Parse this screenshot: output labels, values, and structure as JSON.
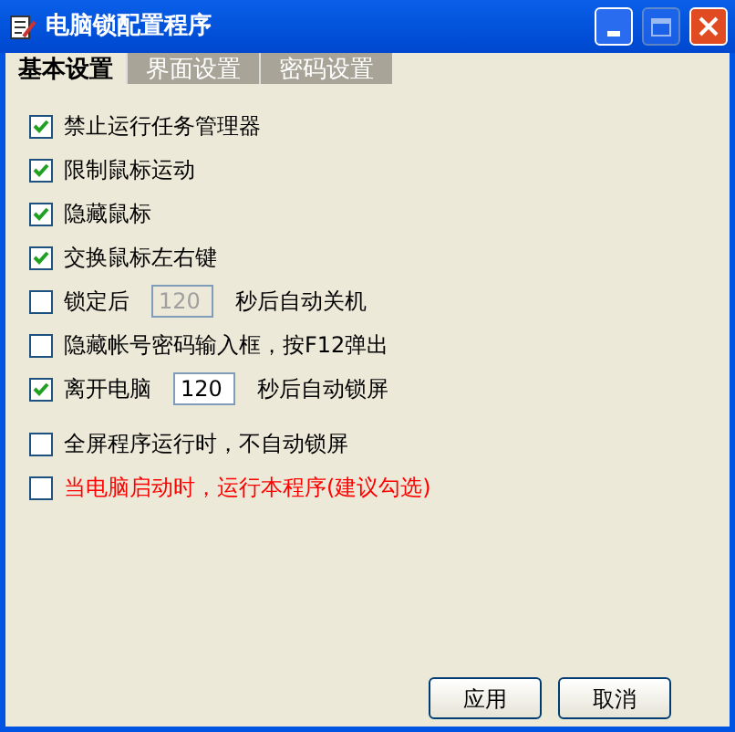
{
  "window": {
    "title": "电脑锁配置程序"
  },
  "tabs": [
    {
      "label": "基本设置",
      "selected": true
    },
    {
      "label": "界面设置",
      "selected": false
    },
    {
      "label": "密码设置",
      "selected": false
    }
  ],
  "options": [
    {
      "kind": "check",
      "label": "禁止运行任务管理器",
      "checked": true,
      "emphasis": false
    },
    {
      "kind": "check",
      "label": "限制鼠标运动",
      "checked": true,
      "emphasis": false
    },
    {
      "kind": "check",
      "label": "隐藏鼠标",
      "checked": true,
      "emphasis": false
    },
    {
      "kind": "check",
      "label": "交换鼠标左右键",
      "checked": true,
      "emphasis": false
    },
    {
      "kind": "timed",
      "label": "锁定后",
      "value": "120",
      "suffix": "秒后自动关机",
      "checked": false,
      "disabled": true
    },
    {
      "kind": "check",
      "label": "隐藏帐号密码输入框，按F12弹出",
      "checked": false,
      "emphasis": false
    },
    {
      "kind": "timed",
      "label": "离开电脑",
      "value": "120",
      "suffix": "秒后自动锁屏",
      "checked": true,
      "disabled": false
    },
    {
      "kind": "check",
      "label": "全屏程序运行时，不自动锁屏",
      "checked": false,
      "emphasis": false
    },
    {
      "kind": "check",
      "label": "当电脑启动时，运行本程序(建议勾选)",
      "checked": false,
      "emphasis": true
    }
  ],
  "buttons": [
    "应用",
    "取消"
  ]
}
